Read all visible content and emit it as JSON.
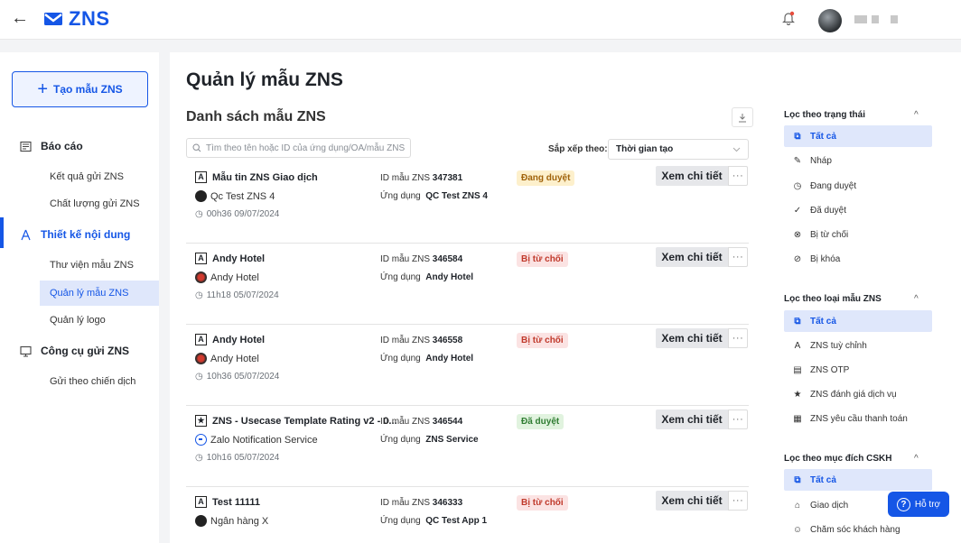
{
  "header": {
    "back_icon": "arrow-left-icon",
    "logo_icon": "mail-icon",
    "logo_text": "ZNS",
    "brand_color": "#1556e6",
    "bell_icon": "bell-icon"
  },
  "sidebar": {
    "create_button": "Tạo mẫu ZNS",
    "groups": [
      {
        "label": "Báo cáo",
        "icon": "report-icon",
        "items": [
          "Kết quả gửi ZNS",
          "Chất lượng gửi ZNS"
        ]
      },
      {
        "label": "Thiết kế nội dung",
        "icon": "design-icon",
        "active": true,
        "items": [
          "Thư viện mẫu ZNS",
          "Quản lý mẫu ZNS",
          "Quản lý logo"
        ]
      },
      {
        "label": "Công cụ gửi ZNS",
        "icon": "monitor-icon",
        "items": [
          "Gửi theo chiến dịch"
        ]
      }
    ],
    "active_item": "Quản lý mẫu ZNS"
  },
  "main": {
    "page_title": "Quản lý mẫu ZNS",
    "list_title": "Danh sách mẫu ZNS",
    "search_placeholder": "Tìm theo tên hoặc ID của ứng dụng/OA/mẫu ZNS",
    "sort_label": "Sắp xếp theo:",
    "sort_value": "Thời gian tạo",
    "id_prefix": "ID mẫu ZNS",
    "app_prefix": "Ứng dụng",
    "view_label": "Xem chi tiết",
    "more_label": "···",
    "templates": [
      {
        "name": "Mẫu tin ZNS Giao dịch",
        "type_icon": "A",
        "sender": "Qc Test ZNS 4",
        "sender_avatar": "dark",
        "time": "00h36 09/07/2024",
        "id": "347381",
        "app": "QC Test ZNS 4",
        "status": "Đang duyệt",
        "status_type": "pending"
      },
      {
        "name": "Andy Hotel",
        "type_icon": "A",
        "sender": "Andy Hotel",
        "sender_avatar": "red",
        "time": "11h18 05/07/2024",
        "id": "346584",
        "app": "Andy Hotel",
        "status": "Bị từ chối",
        "status_type": "rejected"
      },
      {
        "name": "Andy Hotel",
        "type_icon": "A",
        "sender": "Andy Hotel",
        "sender_avatar": "red",
        "time": "10h36 05/07/2024",
        "id": "346558",
        "app": "Andy Hotel",
        "status": "Bị từ chối",
        "status_type": "rejected"
      },
      {
        "name": "ZNS - Usecase Template Rating v2 - 0...",
        "type_icon": "★",
        "sender": "Zalo Notification Service",
        "sender_avatar": "zalo",
        "time": "10h16 05/07/2024",
        "id": "346544",
        "app": "ZNS Service",
        "status": "Đã duyệt",
        "status_type": "approved"
      },
      {
        "name": "Test 11111",
        "type_icon": "A",
        "sender": "Ngân hàng X",
        "sender_avatar": "dark",
        "time": "",
        "id": "346333",
        "app": "QC Test App 1",
        "status": "Bị từ chối",
        "status_type": "rejected"
      }
    ]
  },
  "filters": {
    "status": {
      "title": "Lọc theo trạng thái",
      "items": [
        {
          "label": "Tất cả",
          "icon": "copy-icon",
          "glyph": "⧉",
          "active": true
        },
        {
          "label": "Nháp",
          "icon": "edit-icon",
          "glyph": "✎"
        },
        {
          "label": "Đang duyệt",
          "icon": "clock-icon",
          "glyph": "◷"
        },
        {
          "label": "Đã duyệt",
          "icon": "check-circle-icon",
          "glyph": "✓"
        },
        {
          "label": "Bị từ chối",
          "icon": "x-circle-icon",
          "glyph": "⊗"
        },
        {
          "label": "Bị khóa",
          "icon": "block-icon",
          "glyph": "⊘"
        }
      ]
    },
    "type": {
      "title": "Lọc theo loại mẫu ZNS",
      "items": [
        {
          "label": "Tất cả",
          "icon": "copy-icon",
          "glyph": "⧉",
          "active": true
        },
        {
          "label": "ZNS tuỳ chỉnh",
          "icon": "custom-template-icon",
          "glyph": "A"
        },
        {
          "label": "ZNS OTP",
          "icon": "otp-icon",
          "glyph": "▤"
        },
        {
          "label": "ZNS đánh giá dịch vụ",
          "icon": "rating-icon",
          "glyph": "★"
        },
        {
          "label": "ZNS yêu cầu thanh toán",
          "icon": "payment-icon",
          "glyph": "▦"
        }
      ]
    },
    "purpose": {
      "title": "Lọc theo mục đích CSKH",
      "items": [
        {
          "label": "Tất cả",
          "icon": "copy-icon",
          "glyph": "⧉",
          "active": true
        },
        {
          "label": "Giao dịch",
          "icon": "bag-icon",
          "glyph": "⌂"
        },
        {
          "label": "Chăm sóc khách hàng",
          "icon": "smile-icon",
          "glyph": "☺"
        }
      ]
    },
    "caret": "^"
  },
  "help_button": "Hỗ trợ"
}
